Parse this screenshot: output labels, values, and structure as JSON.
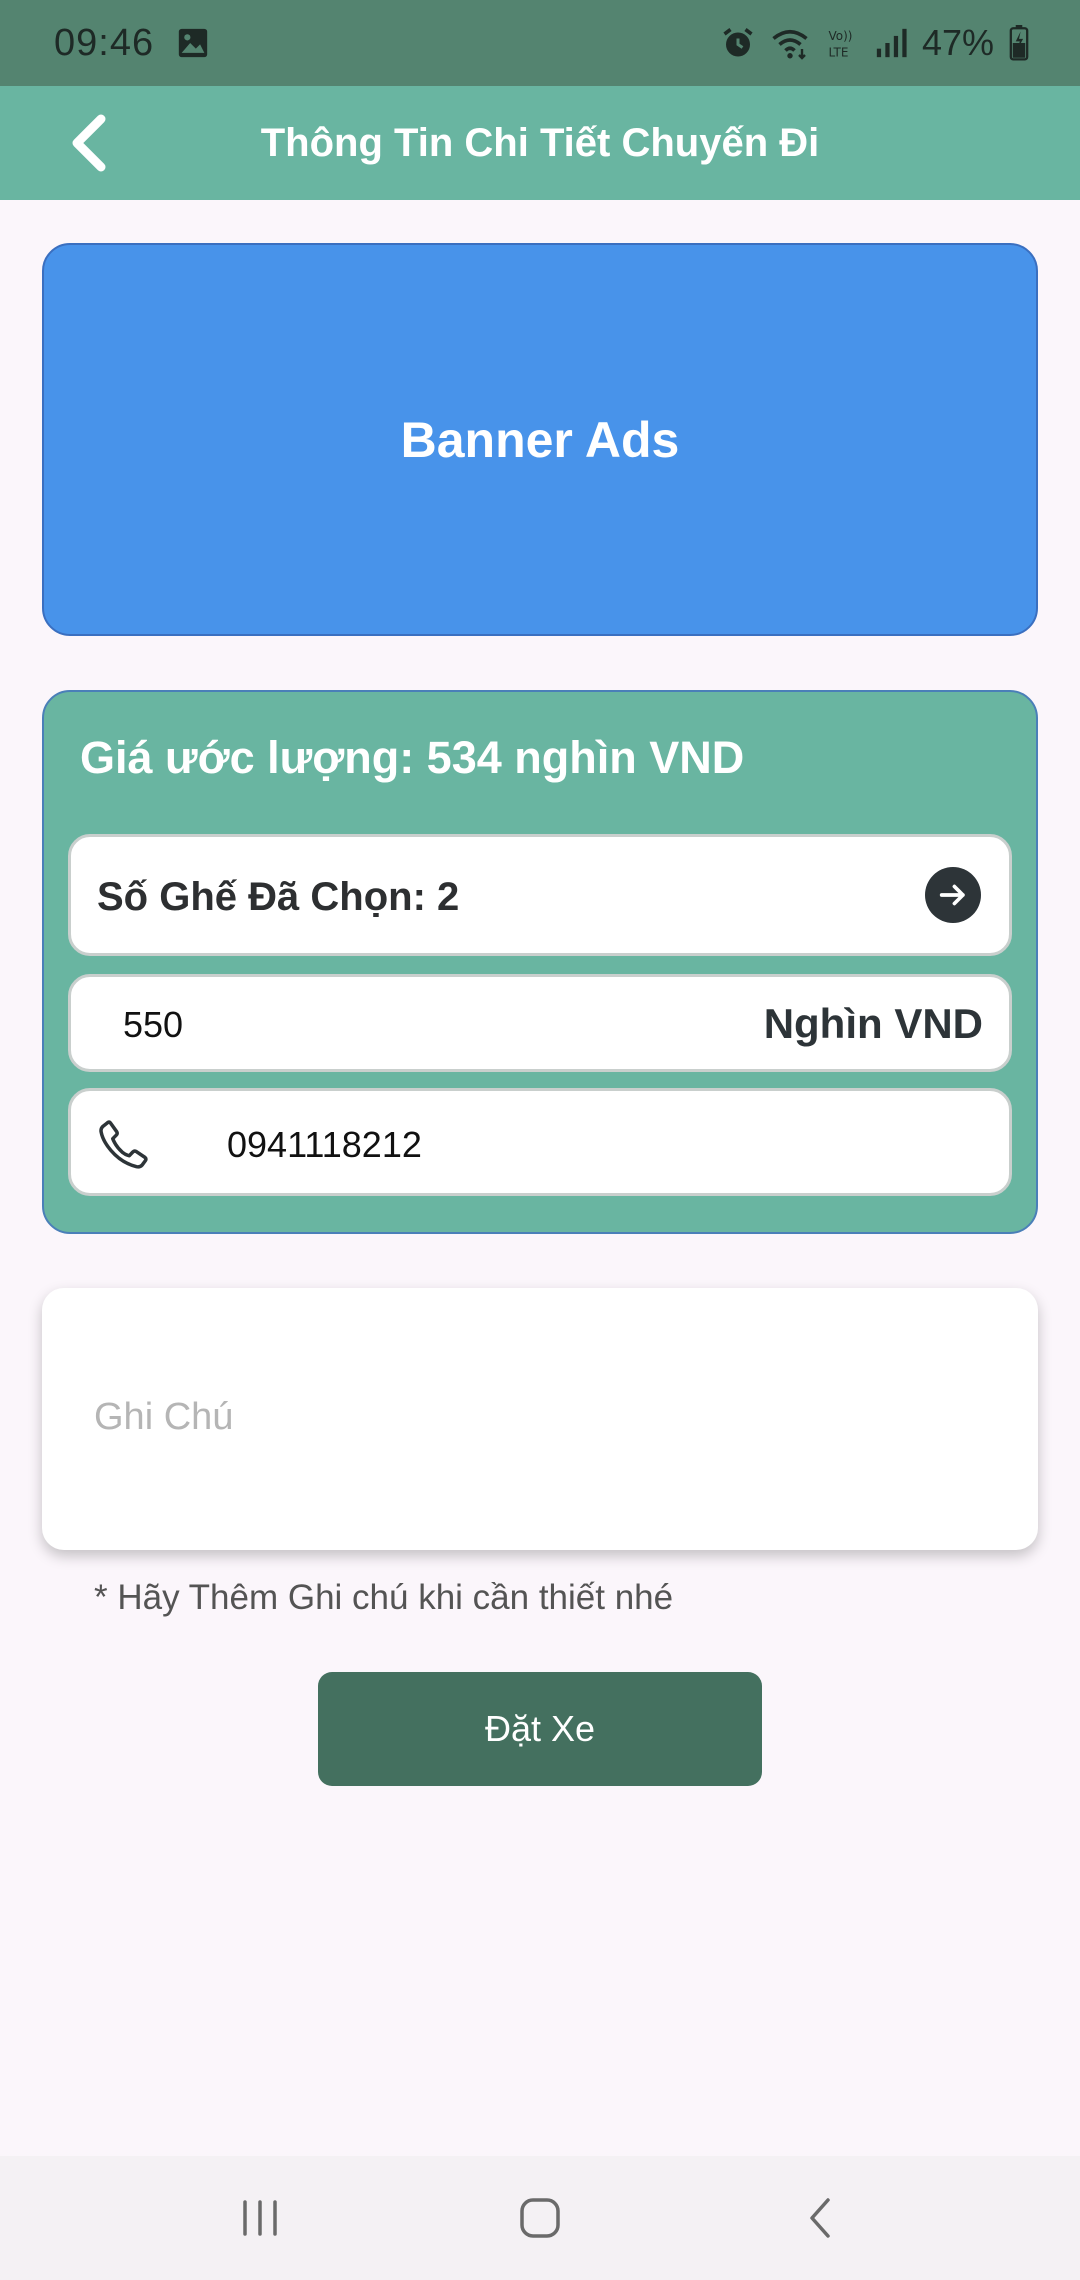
{
  "status_bar": {
    "time": "09:46",
    "battery_percent": "47%",
    "icons": [
      "gallery-icon",
      "alarm-icon",
      "wifi-icon",
      "volte-icon",
      "signal-icon",
      "battery-icon"
    ]
  },
  "app_bar": {
    "title": "Thông Tin Chi Tiết Chuyến Đi",
    "back_icon": "chevron-left-icon"
  },
  "banner": {
    "text": "Banner Ads",
    "color": "#4893ea"
  },
  "trip": {
    "estimate": "Giá ước lượng: 534 nghìn VND",
    "seats_label": "Số Ghế Đã Chọn: 2",
    "seats_action_icon": "arrow-right-circle-icon",
    "price_value": "550",
    "price_unit": "Nghìn VND",
    "phone_icon": "phone-icon",
    "phone_value": "0941118212",
    "card_color": "#69b5a1"
  },
  "notes": {
    "placeholder": "Ghi Chú",
    "value": "",
    "hint": "* Hãy Thêm Ghi chú khi cần thiết nhé"
  },
  "actions": {
    "book_label": "Đặt Xe",
    "book_color": "#44705f"
  },
  "nav_bar": {
    "items": [
      "recent-apps-icon",
      "home-icon",
      "back-icon"
    ]
  }
}
